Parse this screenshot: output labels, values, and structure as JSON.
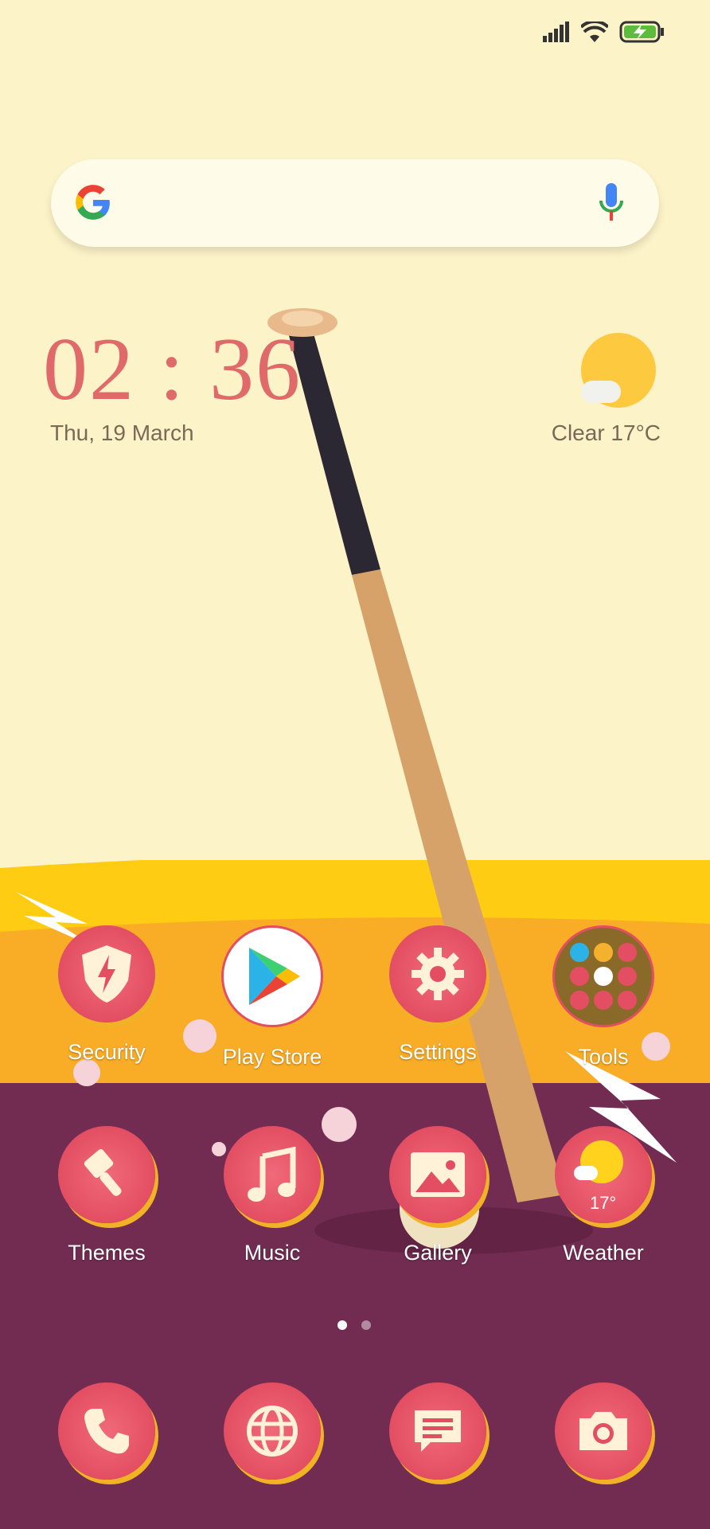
{
  "status_bar": {
    "icons": [
      "signal-icon",
      "wifi-icon",
      "battery-charging-icon"
    ]
  },
  "search": {
    "google_icon": "google-logo-icon",
    "mic_icon": "mic-icon"
  },
  "clock_widget": {
    "time": "02 : 36",
    "date": "Thu, 19 March"
  },
  "weather_widget": {
    "condition_temp": "Clear   17°C"
  },
  "home_row_1": [
    {
      "label": "Security",
      "icon": "shield-icon"
    },
    {
      "label": "Play Store",
      "icon": "play-store-icon"
    },
    {
      "label": "Settings",
      "icon": "gear-icon"
    },
    {
      "label": "Tools",
      "icon": "folder-icon"
    }
  ],
  "home_row_2": [
    {
      "label": "Themes",
      "icon": "paintbrush-icon"
    },
    {
      "label": "Music",
      "icon": "music-note-icon"
    },
    {
      "label": "Gallery",
      "icon": "image-icon"
    },
    {
      "label": "Weather",
      "icon": "weather-icon",
      "badge": "17°"
    }
  ],
  "page_indicator": {
    "pages": 2,
    "active": 1
  },
  "dock": [
    {
      "icon": "phone-icon"
    },
    {
      "icon": "globe-icon"
    },
    {
      "icon": "message-icon"
    },
    {
      "icon": "camera-icon"
    }
  ],
  "colors": {
    "background_top": "#fdf3c8",
    "band_yellow": "#f7b52a",
    "band_purple": "#722c52",
    "icon_red": "#e34e62",
    "clock_red": "#e06a6a"
  }
}
